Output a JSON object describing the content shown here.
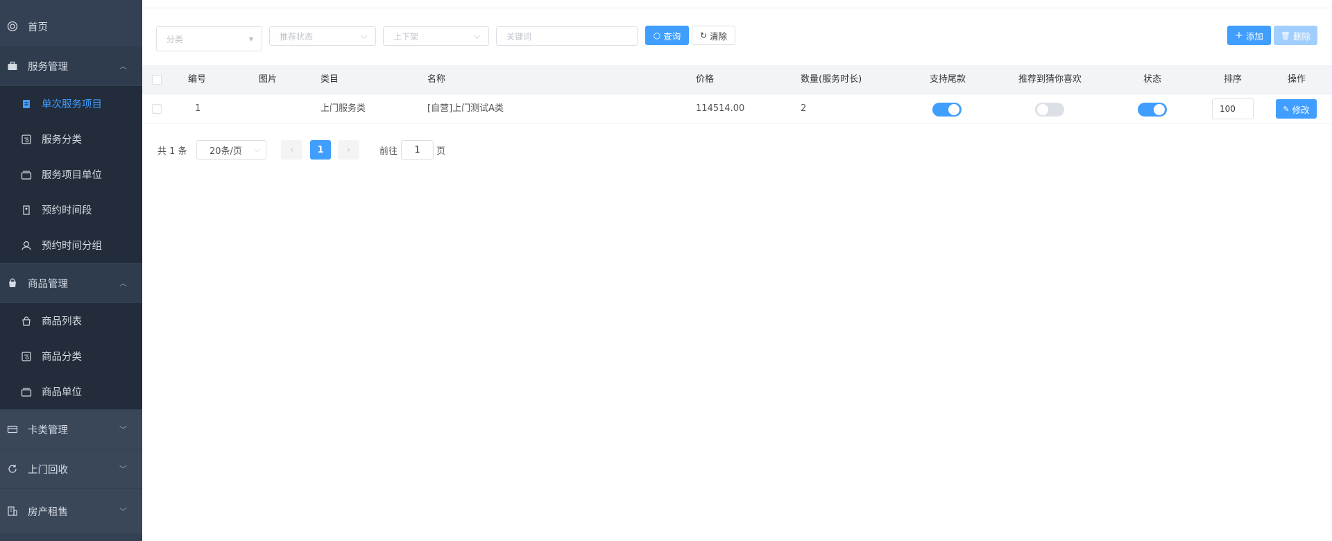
{
  "sidebar": {
    "home": {
      "label": "首页",
      "icon": "home-icon"
    },
    "service_mgmt": {
      "label": "服务管理",
      "icon": "briefcase-icon"
    },
    "service_items": [
      {
        "label": "单次服务项目",
        "icon": "clipboard-icon",
        "active": true
      },
      {
        "label": "服务分类",
        "icon": "category-icon"
      },
      {
        "label": "服务项目单位",
        "icon": "stack-icon"
      },
      {
        "label": "预约时间段",
        "icon": "tag-icon"
      },
      {
        "label": "预约时间分组",
        "icon": "group-icon"
      }
    ],
    "goods_mgmt": {
      "label": "商品管理",
      "icon": "shopping-bag-icon"
    },
    "goods_items": [
      {
        "label": "商品列表",
        "icon": "bag-icon"
      },
      {
        "label": "商品分类",
        "icon": "category-icon"
      },
      {
        "label": "商品单位",
        "icon": "stack-icon"
      }
    ],
    "card_mgmt": {
      "label": "卡类管理",
      "icon": "card-icon"
    },
    "recycle": {
      "label": "上门回收",
      "icon": "refresh-icon"
    },
    "property": {
      "label": "房产租售",
      "icon": "building-icon"
    }
  },
  "filters": {
    "category_placeholder": "分类",
    "recommend_placeholder": "推荐状态",
    "shelf_placeholder": "上下架",
    "keyword_placeholder": "关键词",
    "query_label": "查询",
    "clear_label": "清除"
  },
  "actions": {
    "add_label": "添加",
    "delete_label": "删除"
  },
  "table": {
    "headers": {
      "id": "编号",
      "image": "图片",
      "category": "类目",
      "name": "名称",
      "price": "价格",
      "quantity": "数量(服务时长)",
      "tail_payment": "支持尾款",
      "recommend": "推荐到猜你喜欢",
      "status": "状态",
      "sort": "排序",
      "operation": "操作"
    },
    "rows": [
      {
        "id": "1",
        "category": "上门服务类",
        "name": "[自营]上门测试A类",
        "price": "114514.00",
        "quantity": "2",
        "tail_payment": true,
        "recommend": false,
        "status": true,
        "sort": "100",
        "edit_label": "修改"
      }
    ]
  },
  "pagination": {
    "total_label": "共 1 条",
    "page_size": "20条/页",
    "current_page": "1",
    "goto_prefix": "前往",
    "goto_value": "1",
    "goto_suffix": "页"
  },
  "colors": {
    "accent": "#409eff",
    "sidebar_bg": "#344154",
    "submenu_bg": "#222c3a"
  }
}
